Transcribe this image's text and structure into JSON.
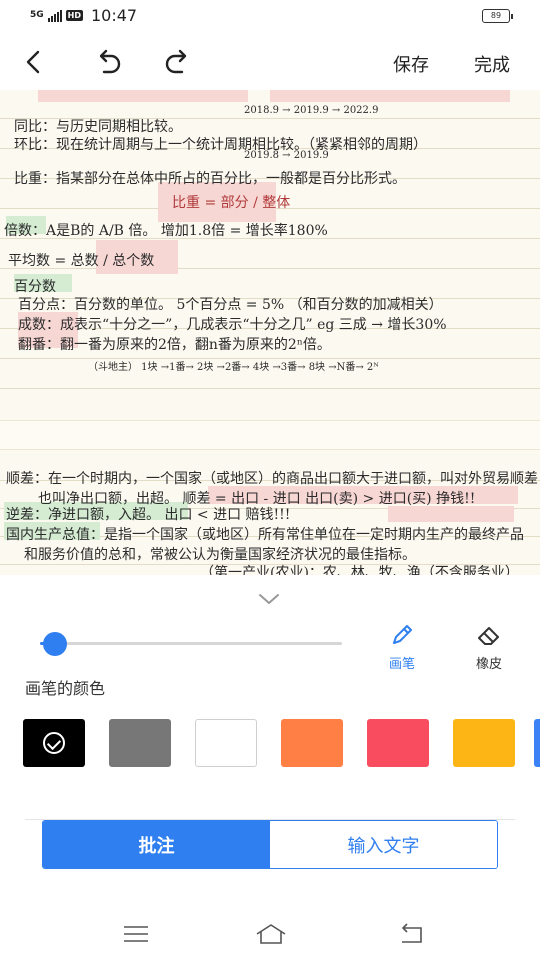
{
  "status_bar": {
    "network": "5G",
    "hd": "HD",
    "time": "10:47",
    "battery": "89"
  },
  "toolbar": {
    "save_label": "保存",
    "done_label": "完成"
  },
  "note": {
    "lines": [
      {
        "text": "同比：与历史同期相比较。",
        "kind": "heading"
      },
      {
        "text": "2018.9 → 2019.9 → 2022.9",
        "kind": "small"
      },
      {
        "text": "环比：现在统计周期与上一个统计周期相比较。（紧紧相邻的周期）",
        "kind": "heading"
      },
      {
        "text": "2019.8 → 2019.9",
        "kind": "small"
      },
      {
        "text": "比重：指某部分在总体中所占的百分比，一般都是百分比形式。",
        "kind": "heading"
      },
      {
        "text": "比重 = 部分 / 整体",
        "kind": "formula"
      },
      {
        "text": "倍数：A是B的 A/B 倍。  增加1.8倍 = 增长率180%",
        "kind": "heading"
      },
      {
        "text": "平均数 = 总数 / 总个数",
        "kind": "formula"
      },
      {
        "text": "百分数",
        "kind": "heading"
      },
      {
        "text": "百分点：百分数的单位。  5个百分点 = 5%  （和百分数的加减相关）",
        "kind": "body"
      },
      {
        "text": "成数：成表示“十分之一”，几成表示“十分之几”  eg 三成 → 增长30%",
        "kind": "body"
      },
      {
        "text": "翻番：翻一番为原来的2倍，翻n番为原来的2ⁿ倍。",
        "kind": "body"
      },
      {
        "text": "（斗地主）  1块 →1番→ 2块 →2番→ 4块 →3番→ 8块 →N番→ 2ᴺ",
        "kind": "small"
      },
      {
        "text": "顺差：在一个时期内，一个国家（或地区）的商品出口额大于进口额，叫对外贸易顺差，",
        "kind": "body"
      },
      {
        "text": "也叫净出口额，出超。  顺差 = 出口 - 进口  出口(卖) > 进口(买)  挣钱!!",
        "kind": "body"
      },
      {
        "text": "逆差：净进口额，入超。              出口 < 进口    赔钱!!!",
        "kind": "body"
      },
      {
        "text": "国内生产总值：是指一个国家（或地区）所有常住单位在一定时期内生产的最终产品",
        "kind": "body"
      },
      {
        "text": "和服务价值的总和，常被公认为衡量国家经济状况的最佳指标。",
        "kind": "body"
      },
      {
        "text": "（第一产业(农业)：农、林、牧、渔（不含服务业）",
        "kind": "body"
      }
    ]
  },
  "panel": {
    "tools": [
      {
        "label": "画笔",
        "icon": "pen-icon",
        "active": true
      },
      {
        "label": "橡皮",
        "icon": "eraser-icon",
        "active": false
      }
    ],
    "color_section_title": "画笔的颜色",
    "brush_size_fraction": 0.05,
    "colors": [
      "#000000",
      "#777777",
      "#ffffff",
      "#ff7f45",
      "#f94c5e",
      "#fdb515"
    ],
    "partial_color": "#3b82f6",
    "selected_color": "#000000",
    "mode_annotate": "批注",
    "mode_text": "输入文字",
    "accent": "#2f7ff0"
  }
}
